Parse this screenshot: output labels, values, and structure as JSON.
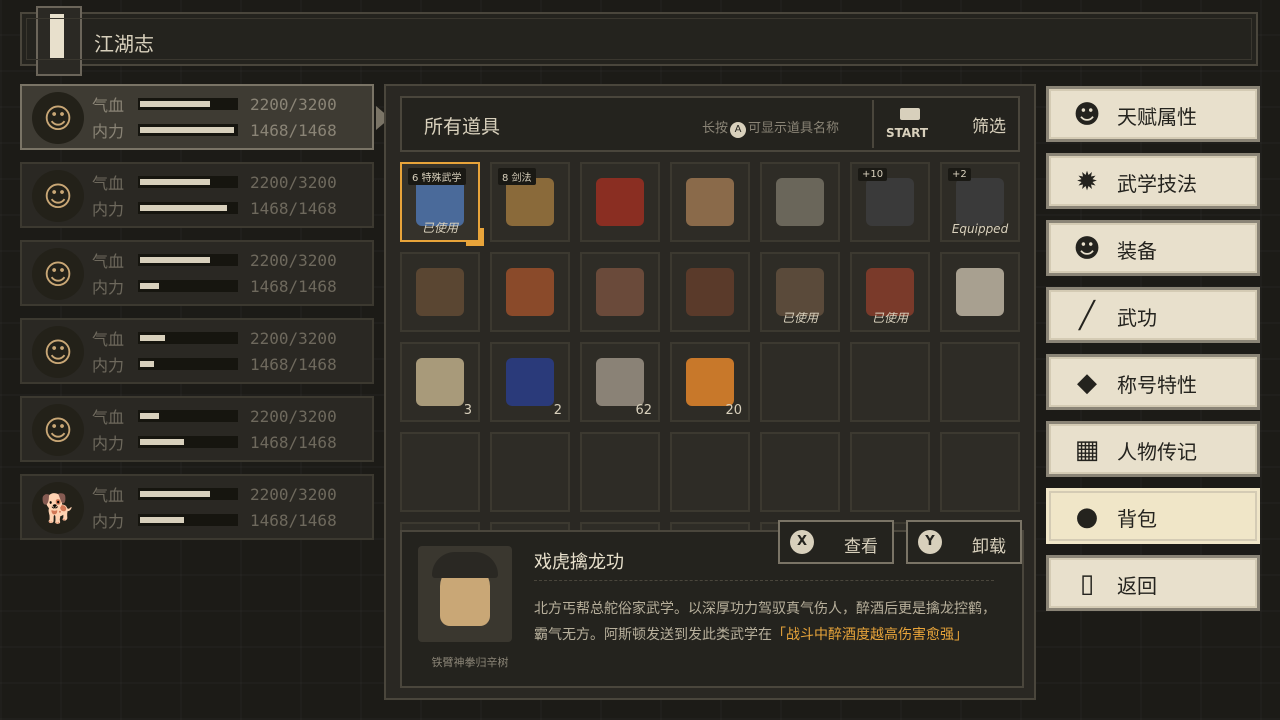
{
  "title": "江湖志",
  "party": [
    {
      "hp_label": "气血",
      "mp_label": "内力",
      "hp": "2200/3200",
      "mp": "1468/1468",
      "hp_frac": 0.73,
      "mp_frac": 0.98,
      "glyph": "☺"
    },
    {
      "hp_label": "气血",
      "mp_label": "内力",
      "hp": "2200/3200",
      "mp": "1468/1468",
      "hp_frac": 0.73,
      "mp_frac": 0.91,
      "glyph": "☺"
    },
    {
      "hp_label": "气血",
      "mp_label": "内力",
      "hp": "2200/3200",
      "mp": "1468/1468",
      "hp_frac": 0.73,
      "mp_frac": 0.2,
      "glyph": "☺"
    },
    {
      "hp_label": "气血",
      "mp_label": "内力",
      "hp": "2200/3200",
      "mp": "1468/1468",
      "hp_frac": 0.26,
      "mp_frac": 0.15,
      "glyph": "☺"
    },
    {
      "hp_label": "气血",
      "mp_label": "内力",
      "hp": "2200/3200",
      "mp": "1468/1468",
      "hp_frac": 0.2,
      "mp_frac": 0.46,
      "glyph": "☺"
    },
    {
      "hp_label": "气血",
      "mp_label": "内力",
      "hp": "2200/3200",
      "mp": "1468/1468",
      "hp_frac": 0.73,
      "mp_frac": 0.46,
      "glyph": "🐕"
    }
  ],
  "inventory": {
    "category": "所有道具",
    "hint_prefix": "长按",
    "hint_button": "A",
    "hint_suffix": "可显示道具名称",
    "start_label": "START",
    "filter_label": "筛选",
    "items": [
      {
        "tag": "6 特殊武学",
        "used": "已使用",
        "color": "#4a6a9a",
        "selected": true
      },
      {
        "tag": "8 剑法",
        "color": "#8a6a3a"
      },
      {
        "color": "#8a2e22"
      },
      {
        "color": "#8a6a4a"
      },
      {
        "color": "#6a665a"
      },
      {
        "tag": "+10",
        "color": "#3a3a3a"
      },
      {
        "tag": "+2",
        "used": "Equipped",
        "color": "#3a3a3a"
      },
      {
        "color": "#5a4632"
      },
      {
        "color": "#8a4a2a"
      },
      {
        "color": "#6a4a3a"
      },
      {
        "color": "#5a3a2a"
      },
      {
        "used": "已使用",
        "color": "#5a4a3a"
      },
      {
        "used": "已使用",
        "color": "#7a3a2a"
      },
      {
        "color": "#a8a090"
      },
      {
        "count": "3",
        "color": "#a89a7a"
      },
      {
        "count": "2",
        "color": "#2a3a7a"
      },
      {
        "count": "62",
        "color": "#8a8276"
      },
      {
        "count": "20",
        "color": "#c8782a"
      }
    ],
    "detail": {
      "skill_name": "戏虎擒龙功",
      "person": "铁臂神拳归辛树",
      "desc_plain": "北方丐帮总舵俗家武学。以深厚功力驾驭真气伤人，醉酒后更是擒龙控鹤，霸气无方。阿斯顿发送到发此类武学在",
      "desc_highlight": "「战斗中醉酒度越高伤害愈强」",
      "btn_view_key": "X",
      "btn_view": "查看",
      "btn_unequip_key": "Y",
      "btn_unequip": "卸载"
    }
  },
  "menu": [
    {
      "label": "天赋属性",
      "icon": "☻"
    },
    {
      "label": "武学技法",
      "icon": "✹"
    },
    {
      "label": "装备",
      "icon": "☻"
    },
    {
      "label": "武功",
      "icon": "╱"
    },
    {
      "label": "称号特性",
      "icon": "◆"
    },
    {
      "label": "人物传记",
      "icon": "▦"
    },
    {
      "label": "背包",
      "icon": "●",
      "active": true
    },
    {
      "label": "返回",
      "icon": "▯"
    }
  ]
}
